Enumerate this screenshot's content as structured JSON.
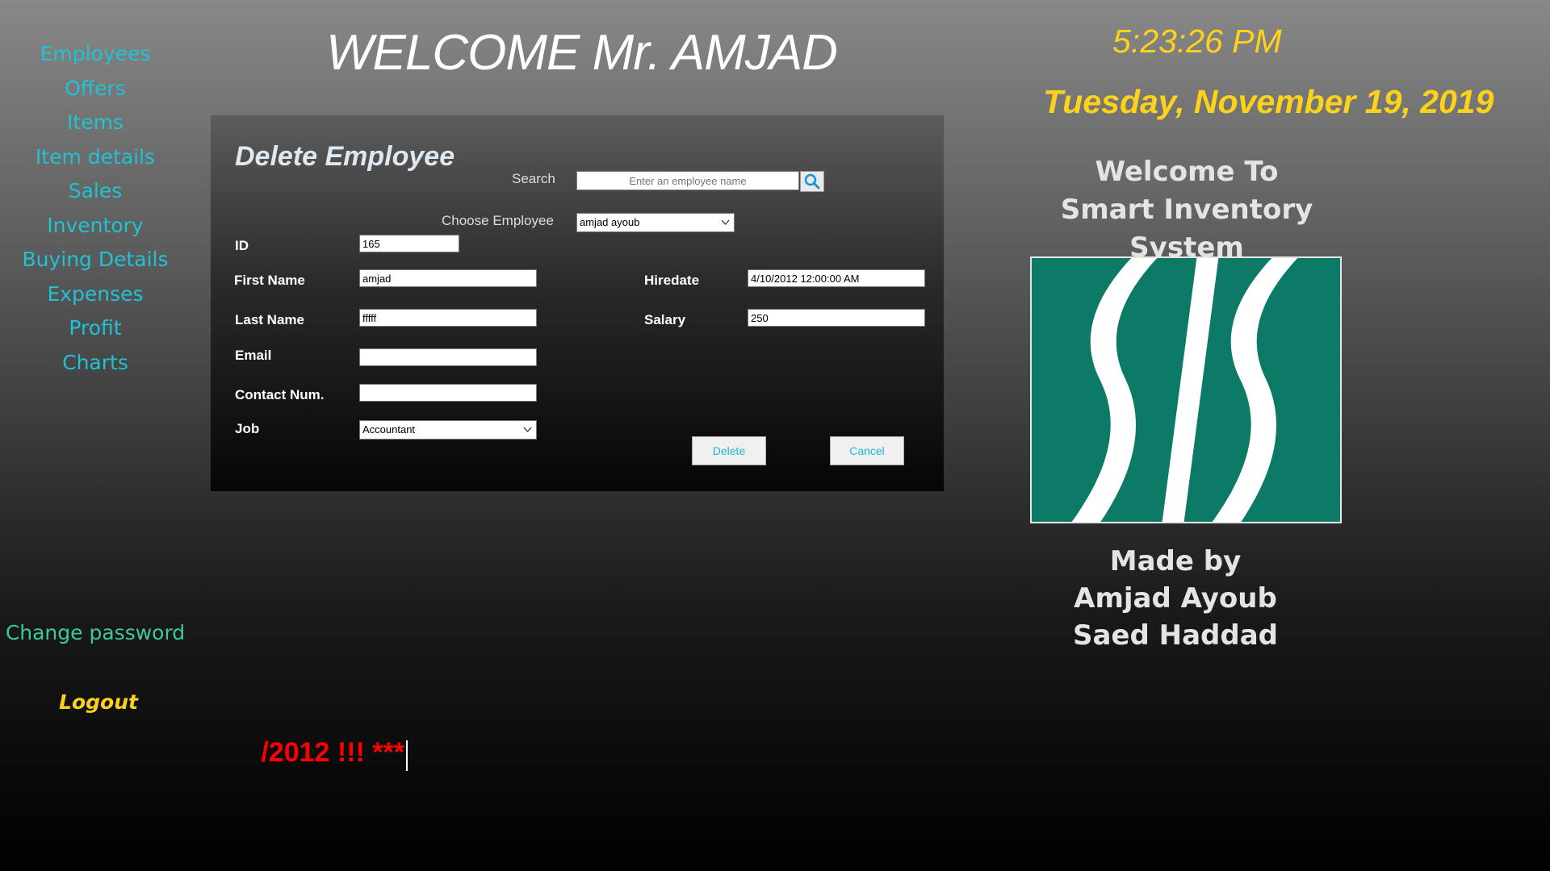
{
  "sidebar": {
    "items": [
      {
        "label": "Employees"
      },
      {
        "label": "Offers"
      },
      {
        "label": "Items"
      },
      {
        "label": "Item details"
      },
      {
        "label": "Sales"
      },
      {
        "label": "Inventory"
      },
      {
        "label": "Buying Details"
      },
      {
        "label": "Expenses"
      },
      {
        "label": "Profit"
      },
      {
        "label": "Charts"
      }
    ],
    "change_password": "Change password",
    "logout": "Logout"
  },
  "header": {
    "welcome": "WELCOME Mr. AMJAD",
    "time": "5:23:26 PM",
    "date": "Tuesday, November 19, 2019"
  },
  "info": {
    "welcome_line1": "Welcome To",
    "welcome_line2": "Smart Inventory System",
    "logo_text": "SIS",
    "made_by": "Made by",
    "author1": "Amjad Ayoub",
    "author2": "Saed Haddad"
  },
  "form": {
    "title": "Delete Employee",
    "search_label": "Search",
    "search_placeholder": "Enter an employee name",
    "choose_label": "Choose Employee",
    "choose_value": "amjad ayoub",
    "id_label": "ID",
    "id_value": "165",
    "first_name_label": "First Name",
    "first_name_value": "amjad",
    "last_name_label": "Last Name",
    "last_name_value": "fffff",
    "email_label": "Email",
    "email_value": "",
    "contact_label": "Contact Num.",
    "contact_value": "",
    "job_label": "Job",
    "job_value": "Accountant",
    "hiredate_label": "Hiredate",
    "hiredate_value": "4/10/2012 12:00:00 AM",
    "salary_label": "Salary",
    "salary_value": "250",
    "delete_button": "Delete",
    "cancel_button": "Cancel"
  },
  "ticker": {
    "text": "/2012 !!!   ***"
  },
  "colors": {
    "nav": "#1fc3d4",
    "accent_yellow": "#ffd21a",
    "logo_green": "#0c7a66",
    "ticker_red": "#ff0000"
  }
}
